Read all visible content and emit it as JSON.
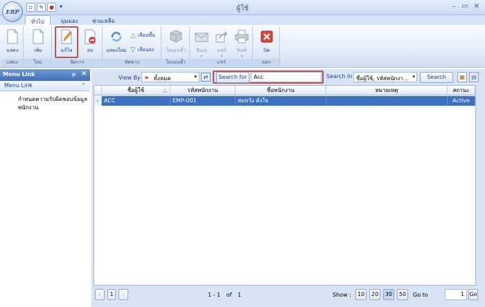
{
  "app": {
    "logo_text": "ERP",
    "title": "ผู้ใช้"
  },
  "tabs": [
    {
      "label": "ทั่วไป"
    },
    {
      "label": "มุมมอง"
    },
    {
      "label": "ช่วยเหลือ"
    }
  ],
  "ribbon": {
    "groups": {
      "show": "แสดง",
      "new": "ใหม่",
      "manage": "จัดการ",
      "navigate": "ทิศทาง",
      "domain": "โดเมนซ้ำ",
      "share": "แชร์",
      "exit": "ออก"
    },
    "buttons": {
      "show": "แสดง",
      "add": "เพิ่ม",
      "edit": "แก้ไข",
      "delete": "ลบ",
      "refresh": "แสดงใหม่",
      "move_up": "เลื่อนขึ้น",
      "move_down": "เลื่อนลง",
      "domain": "โดเมนซ้ำ",
      "email": "อีเมล",
      "share": "แชร์",
      "print": "พิมพ์",
      "close": "ปิด"
    }
  },
  "left_panel": {
    "header": "Menu Link",
    "pin": "ᵽ",
    "close": "×",
    "section": "Menu Link",
    "collapse": "⌃",
    "item": "กำหนดความรับผิดชอบข้อมูลพนักงาน"
  },
  "filter": {
    "view_by_label": "View By",
    "view_by_value": "ทั้งหมด",
    "search_for_label": "Search for",
    "search_for_value": "Acc",
    "search_in_label": "Search In",
    "search_in_value": "ชื่อผู้ใช้, รหัสพนักงา...",
    "search_button": "Search"
  },
  "grid": {
    "columns": [
      "ชื่อผู้ใช้",
      "รหัสพนักงาน",
      "ชื่อพนักงาน",
      "หมายเหตุ",
      "สถานะ"
    ],
    "rows": [
      {
        "user": "ACC",
        "emp_code": "EMP-001",
        "emp_name": "สมหวัง ดังใจ",
        "note": "",
        "status": "Active"
      }
    ]
  },
  "footer": {
    "page": "1",
    "range": "1 - 1",
    "of_label": "of",
    "total": "1",
    "show_label": "Show :",
    "page_sizes": [
      "10",
      "20",
      "30",
      "50"
    ],
    "goto_label": "Go to",
    "goto_value": "1",
    "go_button": "Go"
  },
  "colors": {
    "accent": "#3d70c2",
    "highlight_box": "#c0504d"
  }
}
